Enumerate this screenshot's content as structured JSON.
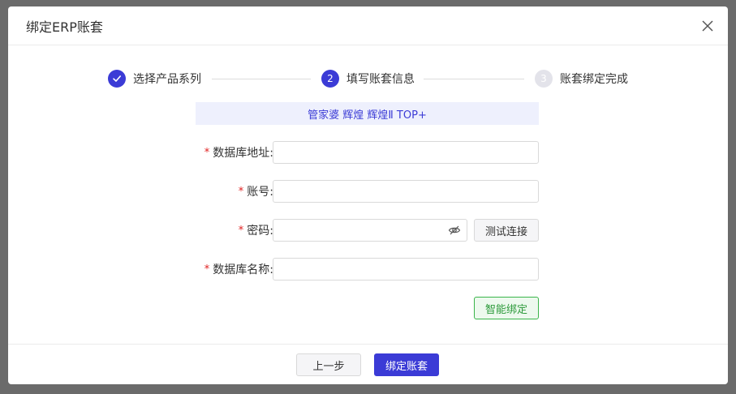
{
  "dialog": {
    "title": "绑定ERP账套"
  },
  "steps": [
    {
      "index": "",
      "label": "选择产品系列",
      "status": "done"
    },
    {
      "index": "2",
      "label": "填写账套信息",
      "status": "active"
    },
    {
      "index": "3",
      "label": "账套绑定完成",
      "status": "pending"
    }
  ],
  "banner": {
    "text": "管家婆 辉煌 辉煌Ⅱ TOP+"
  },
  "form": {
    "required_mark": "*",
    "db_address": {
      "label": "数据库地址:",
      "value": ""
    },
    "account": {
      "label": "账号:",
      "value": ""
    },
    "password": {
      "label": "密码:",
      "value": ""
    },
    "db_name": {
      "label": "数据库名称:",
      "value": ""
    },
    "test_button": "测试连接",
    "smart_bind_button": "智能绑定"
  },
  "footer": {
    "prev_button": "上一步",
    "bind_button": "绑定账套"
  },
  "colors": {
    "primary": "#3b3bd6",
    "required": "#e02020",
    "success": "#3ab54a",
    "overlay": "#6b6b6b"
  }
}
